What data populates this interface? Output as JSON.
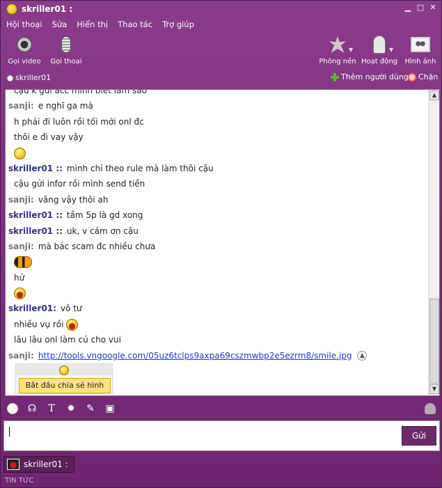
{
  "window": {
    "title": "skriller01 :"
  },
  "menu": [
    "Hội thoại",
    "Sửa",
    "Hiển thị",
    "Thao tác",
    "Trợ giúp"
  ],
  "toolbar": {
    "video_call": "Gọi video",
    "voice_call": "Gọi thoại",
    "background": "Phông nền",
    "activity": "Hoạt động",
    "picture": "Hình ảnh"
  },
  "contact": {
    "name": "skriller01",
    "add_user": "Thêm người dùng",
    "block": "Chặn"
  },
  "chat": [
    {
      "kind": "text",
      "text": "cậu k gửi acc mình biết làm sao"
    },
    {
      "kind": "msg",
      "sender": "sanji:",
      "other": true,
      "text": "e nghĩ ga mà"
    },
    {
      "kind": "text",
      "text": "h phải đi luôn rồi tối mới onl đc"
    },
    {
      "kind": "text",
      "text": "thôi e đi vay vậy"
    },
    {
      "kind": "emoticon",
      "emoticon": "smile"
    },
    {
      "kind": "msg",
      "sender": "skriller01 ::",
      "other": false,
      "text": "mình chỉ theo rule mà làm thôi cậu"
    },
    {
      "kind": "text",
      "text": "cậu gửi infor rồi mình send tiền"
    },
    {
      "kind": "msg",
      "sender": "sanji:",
      "other": true,
      "text": "vâng vậy thôi ah"
    },
    {
      "kind": "msg",
      "sender": "skriller01 ::",
      "other": false,
      "text": "tầm 5p là gd xong"
    },
    {
      "kind": "msg",
      "sender": "skriller01 ::",
      "other": false,
      "text": "uk, v cám ơn cậu"
    },
    {
      "kind": "msg",
      "sender": "sanji:",
      "other": true,
      "text": "mà bác scam đc nhiều chưa"
    },
    {
      "kind": "emoticon",
      "emoticon": "bee"
    },
    {
      "kind": "text",
      "text": "hứ"
    },
    {
      "kind": "emoticon",
      "emoticon": "laugh"
    },
    {
      "kind": "msg",
      "sender": "skriller01:",
      "other": false,
      "text": "vô tư"
    },
    {
      "kind": "text_emo",
      "text": "nhiều vụ rồi",
      "emoticon": "laugh"
    },
    {
      "kind": "text",
      "text": "lâu lâu onl làm cú cho vui"
    },
    {
      "kind": "link",
      "sender": "sanji:",
      "other": true,
      "text": "http://tools.vngoogle.com/05uz6tclps9axpa69cszmwbp2e5ezrm8/smile.jpg"
    }
  ],
  "share": {
    "label": "Bắt đầu chia sẻ hình ảnh"
  },
  "input": {
    "value": "",
    "send_label": "Gửi"
  },
  "tabs": [
    {
      "label": "skriller01 :"
    }
  ],
  "footer": {
    "news_label": "TIN TỨC"
  },
  "colors": {
    "frame": "#7a2f7a",
    "sender_self": "#30308c",
    "sender_other": "#777777",
    "link": "#1b3cc8"
  }
}
